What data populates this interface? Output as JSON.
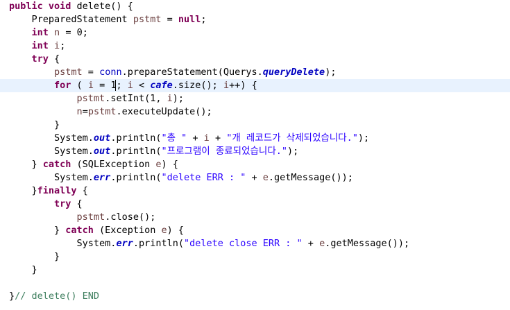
{
  "editor": {
    "language": "java",
    "caret_line": 7,
    "colors": {
      "keyword": "#7f0055",
      "string": "#2a00ff",
      "field": "#0000c0",
      "comment": "#3f7f5f",
      "local_variable": "#6a3e3e",
      "current_line_highlight": "#e8f2fe"
    },
    "lines": [
      [
        {
          "t": "public void",
          "c": "kw"
        },
        {
          "t": " delete() {"
        }
      ],
      [
        {
          "t": "    PreparedStatement "
        },
        {
          "t": "pstmt",
          "c": "lv"
        },
        {
          "t": " = "
        },
        {
          "t": "null",
          "c": "kw"
        },
        {
          "t": ";"
        }
      ],
      [
        {
          "t": "    "
        },
        {
          "t": "int",
          "c": "kw"
        },
        {
          "t": " "
        },
        {
          "t": "n",
          "c": "lv"
        },
        {
          "t": " = 0;"
        }
      ],
      [
        {
          "t": "    "
        },
        {
          "t": "int",
          "c": "kw"
        },
        {
          "t": " "
        },
        {
          "t": "i",
          "c": "lv"
        },
        {
          "t": ";"
        }
      ],
      [
        {
          "t": "    "
        },
        {
          "t": "try",
          "c": "kw"
        },
        {
          "t": " {"
        }
      ],
      [
        {
          "t": "        "
        },
        {
          "t": "pstmt",
          "c": "lv"
        },
        {
          "t": " = "
        },
        {
          "t": "conn",
          "c": "fld"
        },
        {
          "t": ".prepareStatement(Querys."
        },
        {
          "t": "queryDelete",
          "c": "sfld"
        },
        {
          "t": ");"
        }
      ],
      [
        {
          "t": "        "
        },
        {
          "t": "for",
          "c": "kw"
        },
        {
          "t": " ( "
        },
        {
          "t": "i",
          "c": "lv"
        },
        {
          "t": " = 1"
        },
        {
          "caret": true
        },
        {
          "t": "; "
        },
        {
          "t": "i",
          "c": "lv"
        },
        {
          "t": " < "
        },
        {
          "t": "cafe",
          "c": "sfld"
        },
        {
          "t": ".size(); "
        },
        {
          "t": "i",
          "c": "lv"
        },
        {
          "t": "++) {"
        }
      ],
      [
        {
          "t": "            "
        },
        {
          "t": "pstmt",
          "c": "lv"
        },
        {
          "t": ".setInt(1, "
        },
        {
          "t": "i",
          "c": "lv"
        },
        {
          "t": ");"
        }
      ],
      [
        {
          "t": "            "
        },
        {
          "t": "n",
          "c": "lv"
        },
        {
          "t": "="
        },
        {
          "t": "pstmt",
          "c": "lv"
        },
        {
          "t": ".executeUpdate();"
        }
      ],
      [
        {
          "t": "        }"
        }
      ],
      [
        {
          "t": "        System."
        },
        {
          "t": "out",
          "c": "sfld"
        },
        {
          "t": ".println("
        },
        {
          "t": "\"총 \"",
          "c": "str"
        },
        {
          "t": " + "
        },
        {
          "t": "i",
          "c": "lv"
        },
        {
          "t": " + "
        },
        {
          "t": "\"개 레코드가 삭제되었습니다.\"",
          "c": "str"
        },
        {
          "t": ");"
        }
      ],
      [
        {
          "t": "        System."
        },
        {
          "t": "out",
          "c": "sfld"
        },
        {
          "t": ".println("
        },
        {
          "t": "\"프로그램이 종료되었습니다.\"",
          "c": "str"
        },
        {
          "t": ");"
        }
      ],
      [
        {
          "t": "    } "
        },
        {
          "t": "catch",
          "c": "kw"
        },
        {
          "t": " (SQLException "
        },
        {
          "t": "e",
          "c": "lv"
        },
        {
          "t": ") {"
        }
      ],
      [
        {
          "t": "        System."
        },
        {
          "t": "err",
          "c": "sfld"
        },
        {
          "t": ".println("
        },
        {
          "t": "\"delete ERR : \"",
          "c": "str"
        },
        {
          "t": " + "
        },
        {
          "t": "e",
          "c": "lv"
        },
        {
          "t": ".getMessage());"
        }
      ],
      [
        {
          "t": "    }"
        },
        {
          "t": "finally",
          "c": "kw"
        },
        {
          "t": " {"
        }
      ],
      [
        {
          "t": "        "
        },
        {
          "t": "try",
          "c": "kw"
        },
        {
          "t": " {"
        }
      ],
      [
        {
          "t": "            "
        },
        {
          "t": "pstmt",
          "c": "lv"
        },
        {
          "t": ".close();"
        }
      ],
      [
        {
          "t": "        } "
        },
        {
          "t": "catch",
          "c": "kw"
        },
        {
          "t": " (Exception "
        },
        {
          "t": "e",
          "c": "lv"
        },
        {
          "t": ") {"
        }
      ],
      [
        {
          "t": "            System."
        },
        {
          "t": "err",
          "c": "sfld"
        },
        {
          "t": ".println("
        },
        {
          "t": "\"delete close ERR : \"",
          "c": "str"
        },
        {
          "t": " + "
        },
        {
          "t": "e",
          "c": "lv"
        },
        {
          "t": ".getMessage());"
        }
      ],
      [
        {
          "t": "        }"
        }
      ],
      [
        {
          "t": "    }"
        }
      ],
      [
        {
          "t": ""
        }
      ],
      [
        {
          "t": "}"
        },
        {
          "t": "// delete() END",
          "c": "cmt"
        }
      ]
    ]
  }
}
